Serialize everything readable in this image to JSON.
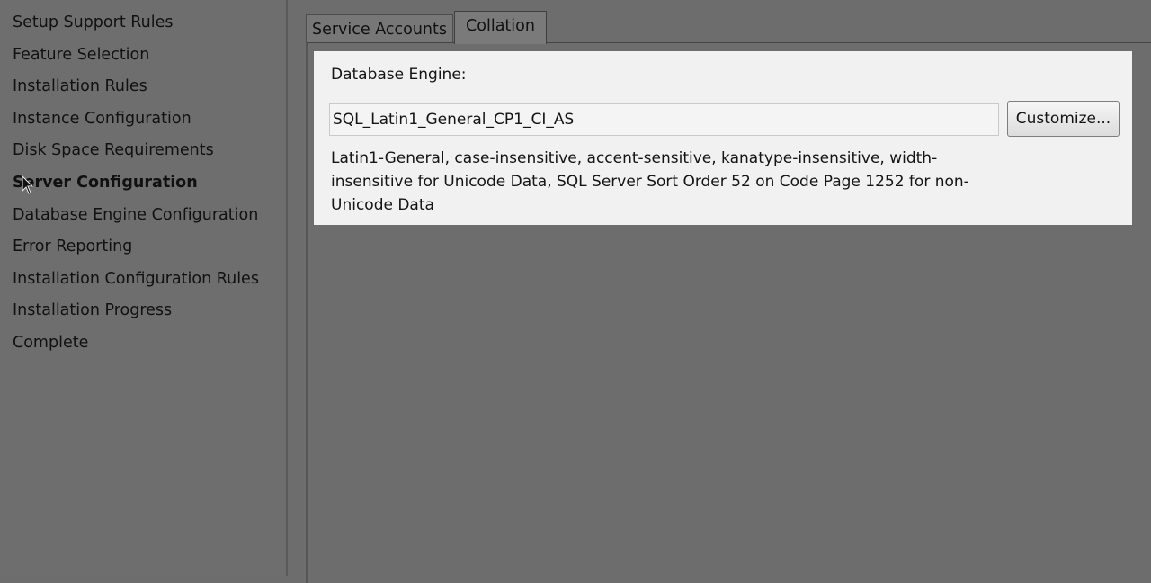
{
  "sidebar": {
    "items": [
      {
        "label": "Setup Support Rules"
      },
      {
        "label": "Feature Selection"
      },
      {
        "label": "Installation Rules"
      },
      {
        "label": "Instance Configuration"
      },
      {
        "label": "Disk Space Requirements"
      },
      {
        "label": "Server Configuration",
        "active": true
      },
      {
        "label": "Database Engine Configuration"
      },
      {
        "label": "Error Reporting"
      },
      {
        "label": "Installation Configuration Rules"
      },
      {
        "label": "Installation Progress"
      },
      {
        "label": "Complete"
      }
    ]
  },
  "tabs": [
    {
      "label": "Service Accounts"
    },
    {
      "label": "Collation",
      "selected": true
    }
  ],
  "collation": {
    "section_label": "Database Engine:",
    "value": "SQL_Latin1_General_CP1_CI_AS",
    "customize_label": "Customize...",
    "description_lines": [
      "Latin1-General, case-insensitive, accent-sensitive, kanatype-insensitive, width-",
      "insensitive for Unicode Data, SQL Server Sort Order 52 on Code Page 1252 for non-",
      "Unicode Data"
    ]
  }
}
